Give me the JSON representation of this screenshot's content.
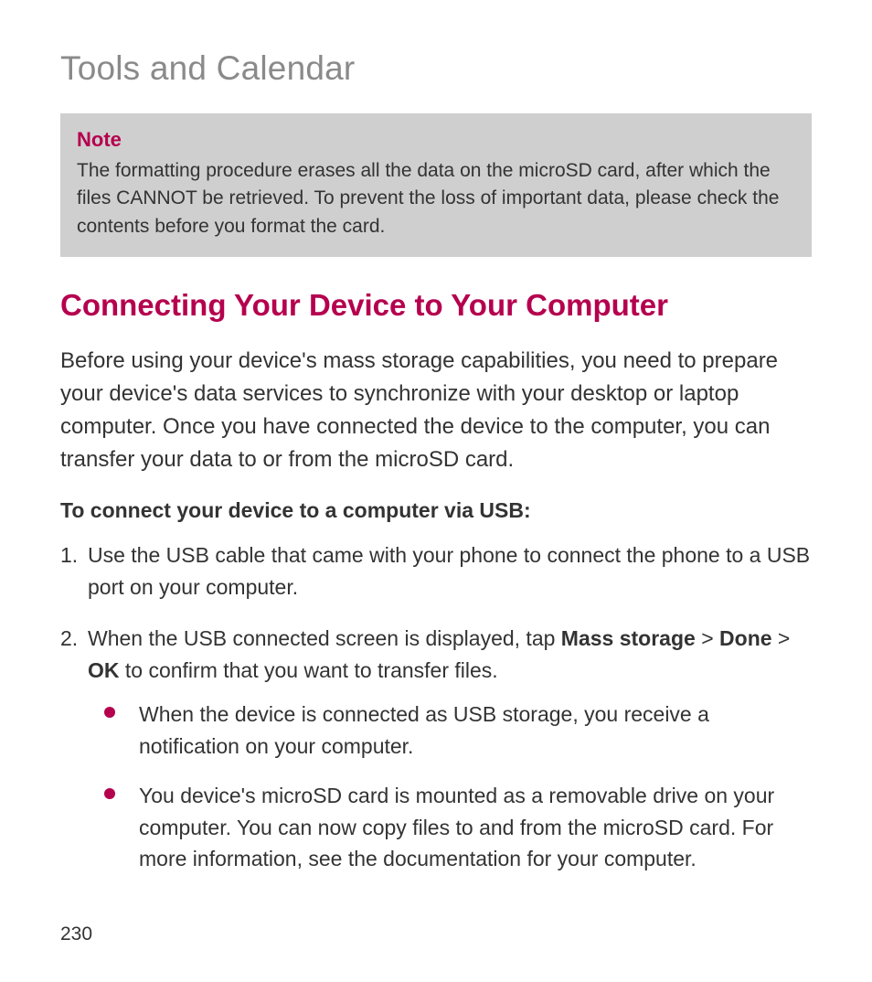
{
  "chapter_title": "Tools and Calendar",
  "note": {
    "label": "Note",
    "body": "The formatting procedure erases all the data on the microSD card, after which the files CANNOT be retrieved. To prevent the loss of important data, please check the contents before you format the card."
  },
  "section": {
    "heading": "Connecting Your Device to Your Computer",
    "intro": "Before using your device's mass storage capabilities, you need to prepare your device's data services to synchronize with your desktop or laptop computer. Once you have connected the device to the computer, you can transfer your data to or from the microSD card.",
    "sub_heading": "To connect your device to a computer via USB:"
  },
  "steps": {
    "s1": "Use the USB cable that came with your phone to connect the phone to a USB port on your computer.",
    "s2_a": "When the USB connected screen is displayed, tap ",
    "s2_b1": "Mass storage",
    "s2_sep1": " > ",
    "s2_b2": "Done",
    "s2_sep2": " > ",
    "s2_b3": "OK",
    "s2_c": " to confirm that you want to transfer files."
  },
  "bullets": {
    "b1": "When the device is connected as USB storage, you receive a notification on your computer.",
    "b2": "You device's microSD card is mounted as a removable drive on your computer. You can now copy files to and from the microSD card. For more information, see the documentation for your computer."
  },
  "page_number": "230"
}
